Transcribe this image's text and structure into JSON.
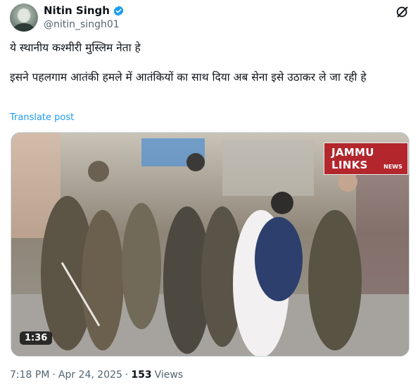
{
  "author": {
    "name": "Nitin Singh",
    "handle": "@nitin_singh01"
  },
  "tweet": {
    "text": "ये स्थानीय कश्मीरी मुस्लिम नेता हे\n\nइसने पहलगाम आतंकी हमले में आतंकियों का साथ दिया अब सेना इसे उठाकर ले जा रही हे",
    "translate_label": "Translate post"
  },
  "video": {
    "overlay_logo": "JAMMU LINKS",
    "overlay_logo_sub": "NEWS",
    "duration": "1:36"
  },
  "meta": {
    "time": "7:18 PM",
    "separator": "·",
    "date": "Apr 24, 2025",
    "views_count": "153",
    "views_label": "Views"
  },
  "icons": {
    "verified": "verified-badge-icon",
    "grok": "grok-icon"
  },
  "colors": {
    "accent": "#1d9bf0",
    "secondary_text": "#536471",
    "logo_red": "#b3262c"
  }
}
